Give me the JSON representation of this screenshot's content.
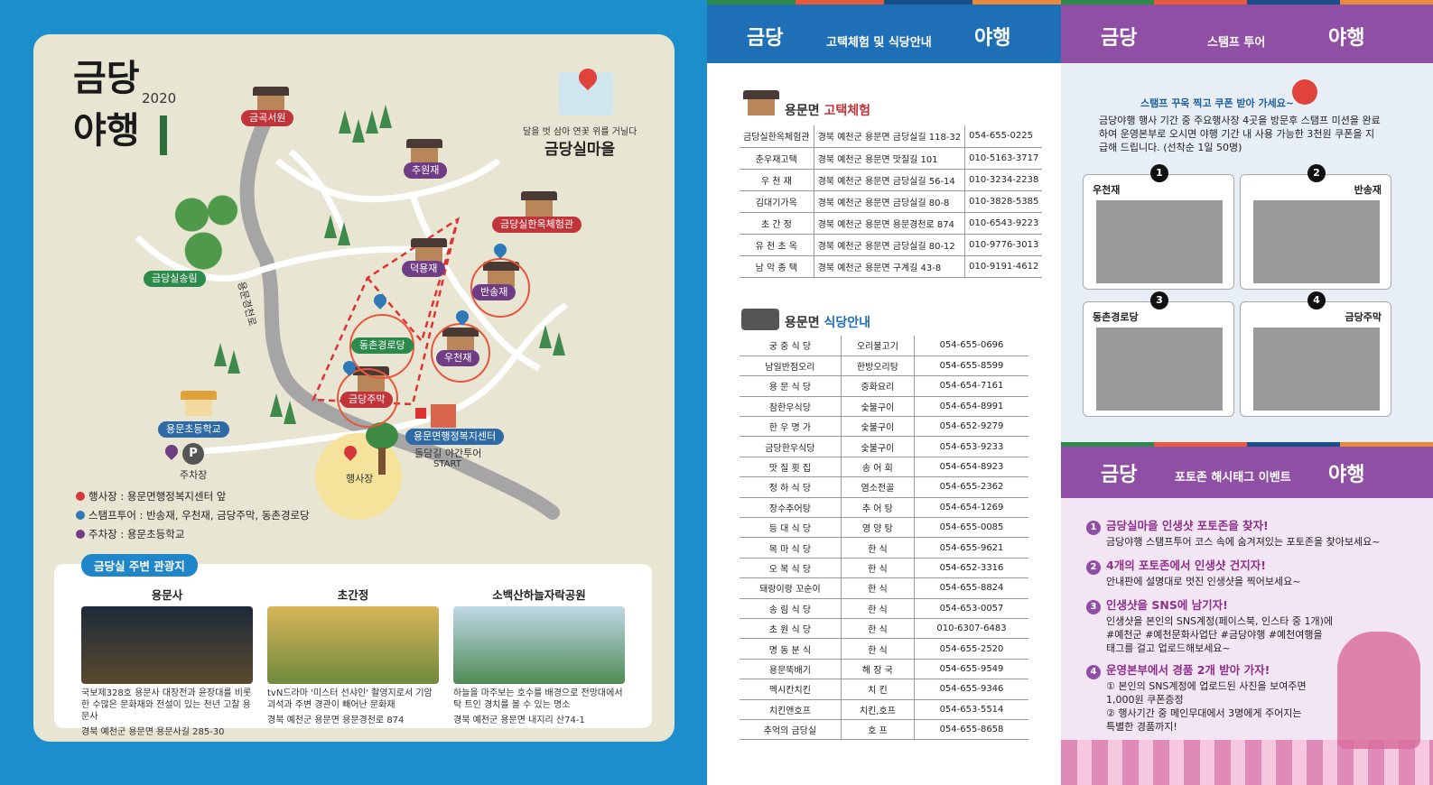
{
  "map": {
    "logo_top": "금당",
    "logo_year": "2020",
    "logo_bottom": "야행",
    "village_caption": "달을 벗 삼아 연꽃 위를 거닐다",
    "village_name": "금당실마을",
    "places": {
      "geumgok": "금곡서원",
      "chuwon": "추원재",
      "hanok": "금당실한옥체험관",
      "deokyong": "덕용재",
      "bansong": "반송재",
      "songrim": "금당실송림",
      "dongchon": "동촌경로당",
      "ucheon": "우천재",
      "jumak": "금당주막",
      "school": "용문초등학교",
      "center": "용문면행정복지센터",
      "parking": "주차장",
      "parking_letter": "P",
      "event_site": "행사장",
      "tour_start_1": "돌담길 야간투어",
      "tour_start_2": "START",
      "road": "용문경천로"
    },
    "legend": {
      "event": "행사장 : 용문면행정복지센터 앞",
      "stamp": "스탬프투어 : 반송재, 우천재, 금당주막, 동촌경로당",
      "parking": "주차장 : 용문초등학교"
    },
    "colors": {
      "red": "#c0343a",
      "purple": "#6f3d84",
      "green": "#2c8a4b",
      "blue": "#2e6aa6"
    }
  },
  "sights": {
    "title": "금당실 주변 관광지",
    "items": [
      {
        "name": "용문사",
        "desc": "국보제328호 용문사 대장전과 윤장대를 비롯한 수많은 문화재와 전설이 있는 천년 고찰 용문사",
        "addr": "경북 예천군 용문면 용문사길 285-30"
      },
      {
        "name": "초간정",
        "desc": "tvN드라마 '미스터 선샤인' 촬영지로서 기암괴석과 주변 경관이 빼어난 문화재",
        "addr": "경북 예천군 용문면 용문경천로 874"
      },
      {
        "name": "소백산하늘자락공원",
        "desc": "하늘을 마주보는 호수를 배경으로 전망대에서 탁 트인 경치를 볼 수 있는 명소",
        "addr": "경북 예천군 용문면 내지리 산74-1"
      }
    ]
  },
  "middle": {
    "brand_left": "금당",
    "brand_right": "야행",
    "title": "고택체험 및 식당안내",
    "lodging_title_a": "용문면",
    "lodging_title_b": "고택체험",
    "lodging": [
      [
        "금당실한옥체험관",
        "경북 예천군 용문면 금당실길 118-32",
        "054-655-0225"
      ],
      [
        "춘우재고택",
        "경북 예천군 용문면 맛질길 101",
        "010-5163-3717"
      ],
      [
        "우 천 재",
        "경북 예천군 용문면 금당실길 56-14",
        "010-3234-2238"
      ],
      [
        "김대기가옥",
        "경북 예천군 용문면 금당실길 80-8",
        "010-3828-5385"
      ],
      [
        "초 간 정",
        "경북 예천군 용문면 용문경천로 874",
        "010-6543-9223"
      ],
      [
        "유 천 초 옥",
        "경북 예천군 용문면 금당실길 80-12",
        "010-9776-3013"
      ],
      [
        "남 악 종 택",
        "경북 예천군 용문면 구계길 43-8",
        "010-9191-4612"
      ]
    ],
    "food_title_a": "용문면",
    "food_title_b": "식당안내",
    "restaurants": [
      [
        "궁 중 식 당",
        "오리불고기",
        "054-655-0696"
      ],
      [
        "남일반점오리",
        "한방오리탕",
        "054-655-8599"
      ],
      [
        "용 문 식 당",
        "중화요리",
        "054-654-7161"
      ],
      [
        "참한우식당",
        "숯불구이",
        "054-654-8991"
      ],
      [
        "한 우 명 가",
        "숯불구이",
        "054-652-9279"
      ],
      [
        "금당한우식당",
        "숯불구이",
        "054-653-9233"
      ],
      [
        "맛 질 횟 집",
        "송 어 회",
        "054-654-8923"
      ],
      [
        "정 하 식 당",
        "염소전골",
        "054-655-2362"
      ],
      [
        "장수추어탕",
        "추 어 탕",
        "054-654-1269"
      ],
      [
        "등 대 식 당",
        "영 양 탕",
        "054-655-0085"
      ],
      [
        "목 마 식 당",
        "한 식",
        "054-655-9621"
      ],
      [
        "오 복 식 당",
        "한 식",
        "054-652-3316"
      ],
      [
        "돼랑이랑 꼬순이",
        "한 식",
        "054-655-8824"
      ],
      [
        "송 림 식 당",
        "한 식",
        "054-653-0057"
      ],
      [
        "초 원 식 당",
        "한 식",
        "010-6307-6483"
      ],
      [
        "명 동 분 식",
        "한 식",
        "054-655-2520"
      ],
      [
        "용문뚝배기",
        "해 장 국",
        "054-655-9549"
      ],
      [
        "멕시칸치킨",
        "치 킨",
        "054-655-9346"
      ],
      [
        "치킨앤호프",
        "치킨,호프",
        "054-653-5514"
      ],
      [
        "추억의 금당실",
        "호 프",
        "054-655-8658"
      ]
    ]
  },
  "stamp": {
    "brand_left": "금당",
    "brand_right": "야행",
    "title": "스탬프 투어",
    "slogan": "스탬프 꾸욱 찍고 쿠폰 받아 가세요~",
    "desc": "금당야행 행사 기간 중 주요행사장 4곳을 방문후 스탬프 미션을 완료하여 운영본부로 오시면 야행 기간 내 사용 가능한 3천원 쿠폰을 지급해 드립니다. (선착순 1일 50명)",
    "spots": [
      {
        "num": "1",
        "name": "우천재"
      },
      {
        "num": "2",
        "name": "반송재"
      },
      {
        "num": "3",
        "name": "동촌경로당"
      },
      {
        "num": "4",
        "name": "금당주막"
      }
    ]
  },
  "event": {
    "brand_left": "금당",
    "brand_right": "야행",
    "title": "포토존 해시태그 이벤트",
    "steps": [
      {
        "num": "1",
        "head": "금당실마을 인생샷 포토존을 찾자!",
        "body": [
          "금당야행 스탬프투어 코스 속에 숨겨져있는 포토존을 찾아보세요~"
        ]
      },
      {
        "num": "2",
        "head": "4개의 포토존에서 인생샷 건지자!",
        "body": [
          "안내판에 설명대로 멋진 인생샷을 찍어보세요~"
        ]
      },
      {
        "num": "3",
        "head": "인생샷을 SNS에 남기자!",
        "body": [
          "인생샷을 본인의 SNS계정(페이스북, 인스타 중 1개)에",
          "#예천군 #예천문화사업단 #금당야행 #예천여행을",
          "태그를 걸고 업로드해보세요~"
        ]
      },
      {
        "num": "4",
        "head": "운영본부에서 경품 2개 받아 가자!",
        "body": [
          "① 본인의 SNS계정에 업로드된 사진을 보여주면",
          "1,000원 쿠폰증정",
          "② 행사기간 중 메인무대에서 3명에게 주어지는",
          "특별한 경품까지!"
        ]
      }
    ]
  }
}
